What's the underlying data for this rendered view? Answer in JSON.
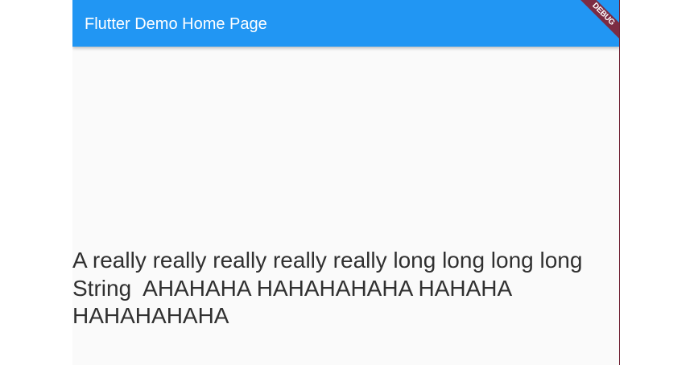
{
  "app_bar": {
    "title": "Flutter Demo Home Page"
  },
  "debug_banner": {
    "label": "DEBUG"
  },
  "body": {
    "text": "A really really really really really long long long long String  AHAHAHA HAHAHAHAHA HAHAHA HAHAHAHAHA"
  },
  "colors": {
    "app_bar": "#2196f3",
    "background": "#fafafa",
    "banner": "#7c2c43",
    "text": "#303030"
  }
}
